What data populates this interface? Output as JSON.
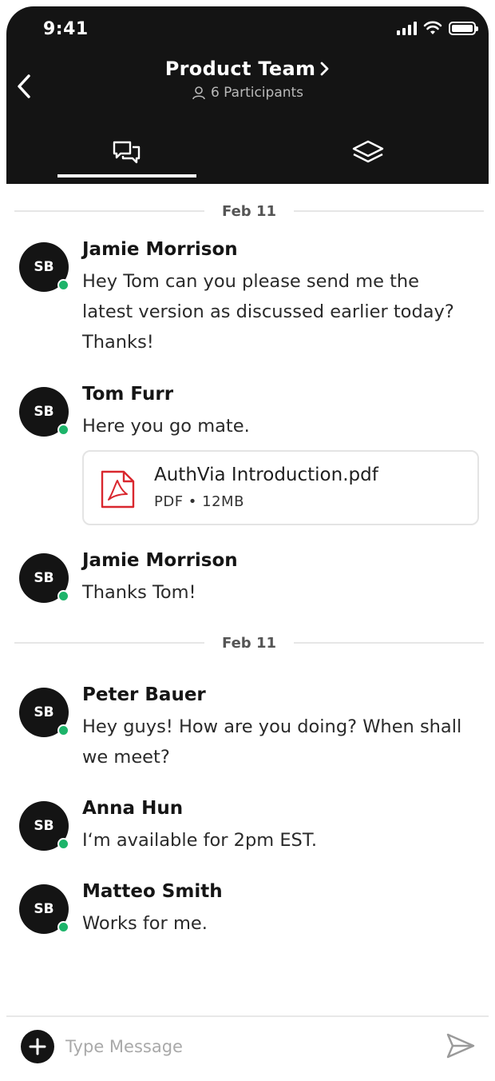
{
  "status_bar": {
    "time": "9:41"
  },
  "header": {
    "title": "Product Team",
    "title_chevron": "›",
    "participants": "6 Participants"
  },
  "tabs": [
    {
      "icon": "chat-bubbles-icon",
      "active": true
    },
    {
      "icon": "layers-icon",
      "active": false
    }
  ],
  "feed": {
    "date_separators": [
      "Feb 11",
      "Feb 11"
    ],
    "messages": [
      {
        "initials": "SB",
        "name": "Jamie Morrison",
        "text": "Hey Tom can you please send me the latest version as discussed earlier today? Thanks!",
        "online": true
      },
      {
        "initials": "SB",
        "name": "Tom Furr",
        "text": "Here you go mate.",
        "online": true,
        "attachment": {
          "filename": "AuthVia Introduction.pdf",
          "type": "PDF",
          "size": "12MB",
          "meta": "PDF • 12MB",
          "icon": "pdf-file-icon"
        }
      },
      {
        "initials": "SB",
        "name": "Jamie Morrison",
        "text": "Thanks Tom!",
        "online": true
      },
      {
        "initials": "SB",
        "name": "Peter Bauer",
        "text": "Hey guys! How are you doing? When shall we meet?",
        "online": true
      },
      {
        "initials": "SB",
        "name": "Anna Hun",
        "text": "I‘m available for 2pm EST.",
        "online": true
      },
      {
        "initials": "SB",
        "name": "Matteo Smith",
        "text": "Works for me.",
        "online": true
      }
    ]
  },
  "composer": {
    "placeholder": "Type Message"
  },
  "colors": {
    "header_bg": "#141414",
    "online": "#1db46a",
    "pdf_red": "#d9272e"
  }
}
